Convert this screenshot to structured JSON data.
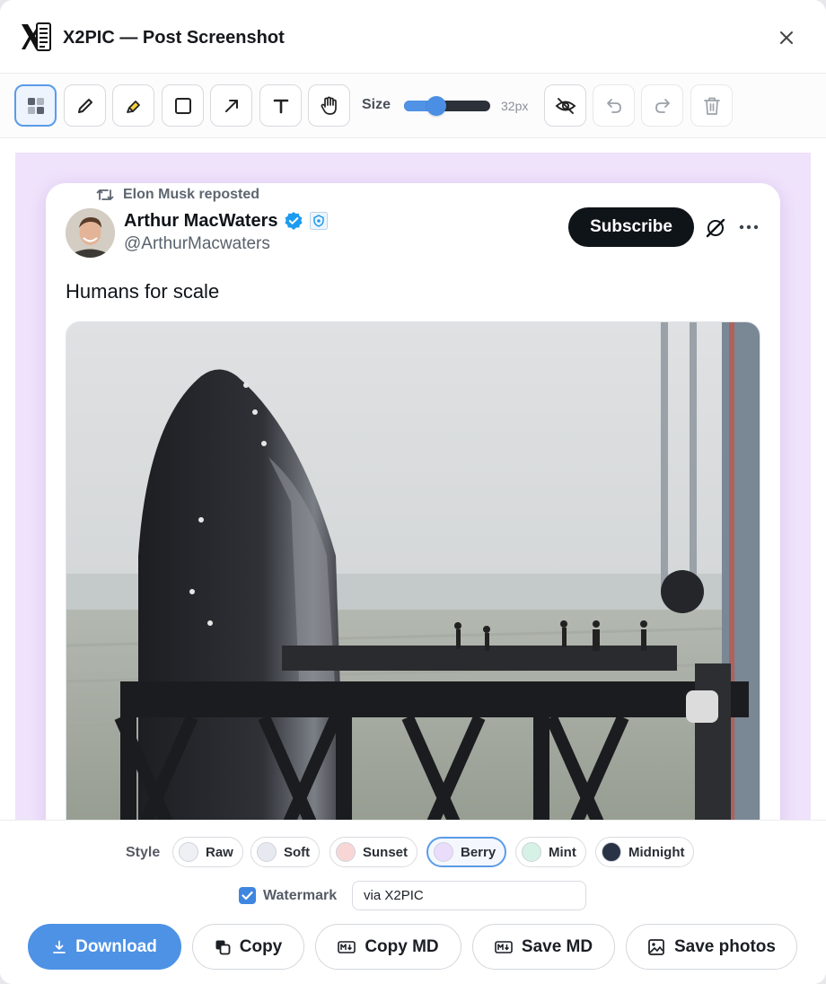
{
  "header": {
    "title": "X2PIC — Post Screenshot"
  },
  "toolbar": {
    "tools": [
      "select-mosaic",
      "pencil",
      "highlighter",
      "rectangle",
      "arrow",
      "text",
      "hand"
    ],
    "size_label": "Size",
    "size_value": "32px",
    "size_fraction": 0.38
  },
  "post": {
    "repost_label": "Elon Musk reposted",
    "author_name": "Arthur MacWaters",
    "author_handle": "@ArthurMacwaters",
    "subscribe_label": "Subscribe",
    "text": "Humans for scale"
  },
  "style": {
    "label": "Style",
    "options": [
      {
        "label": "Raw",
        "color": "#eef0f4"
      },
      {
        "label": "Soft",
        "color": "#e6e9f0"
      },
      {
        "label": "Sunset",
        "color": "#f9d6d6"
      },
      {
        "label": "Berry",
        "color": "#eadcfb"
      },
      {
        "label": "Mint",
        "color": "#d6f1e5"
      },
      {
        "label": "Midnight",
        "color": "#2a3346"
      }
    ],
    "selected": "Berry"
  },
  "watermark": {
    "label": "Watermark",
    "value": "via X2PIC",
    "checked": true
  },
  "actions": {
    "download": "Download",
    "copy": "Copy",
    "copy_md": "Copy MD",
    "save_md": "Save MD",
    "save_photos": "Save photos"
  },
  "colors": {
    "accent": "#4d92e5",
    "canvas_bg": "#efe2fb",
    "verified": "#1d9bf0"
  }
}
